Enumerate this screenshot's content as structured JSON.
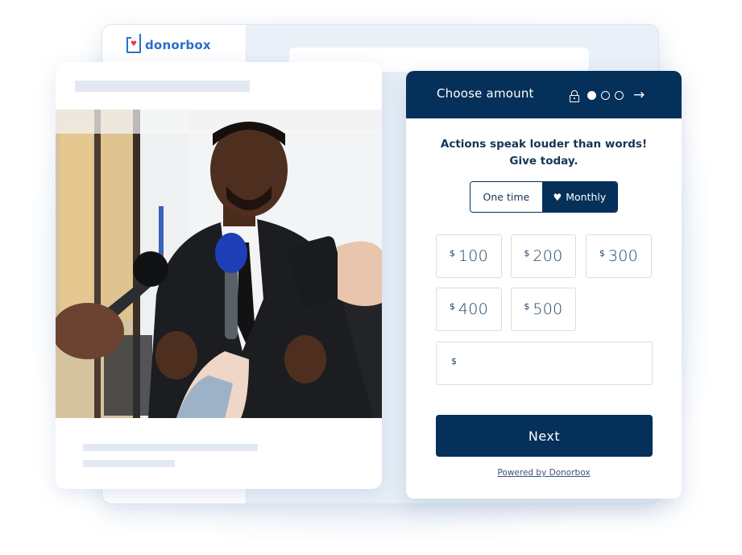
{
  "brand": {
    "name": "donorbox",
    "colors": {
      "primary": "#04305a",
      "logo_blue": "#2a6fc9",
      "heart_red": "#e8384f",
      "skeleton": "#e3e9f2"
    }
  },
  "content_card": {
    "image_description": "Man in a dark suit speaking to reporters holding microphones and a phone",
    "skeleton_lines": 3
  },
  "form": {
    "header": {
      "title": "Choose amount",
      "lock_icon": "lock-icon",
      "steps": [
        {
          "state": "active"
        },
        {
          "state": "inactive"
        },
        {
          "state": "inactive"
        }
      ],
      "next_icon": "arrow-right-icon",
      "arrow_glyph": "→"
    },
    "tagline_line1": "Actions speak louder than words!",
    "tagline_line2": "Give today.",
    "frequency": {
      "options": [
        {
          "label": "One time",
          "selected": false
        },
        {
          "label": "Monthly",
          "selected": true,
          "icon": "heart-icon",
          "glyph": "♥"
        }
      ]
    },
    "currency_symbol": "$",
    "amounts": [
      {
        "value": "100"
      },
      {
        "value": "200"
      },
      {
        "value": "300"
      },
      {
        "value": "400"
      },
      {
        "value": "500"
      }
    ],
    "custom_amount": {
      "value": "",
      "placeholder": ""
    },
    "next_label": "Next",
    "powered_by": "Powered by Donorbox"
  }
}
